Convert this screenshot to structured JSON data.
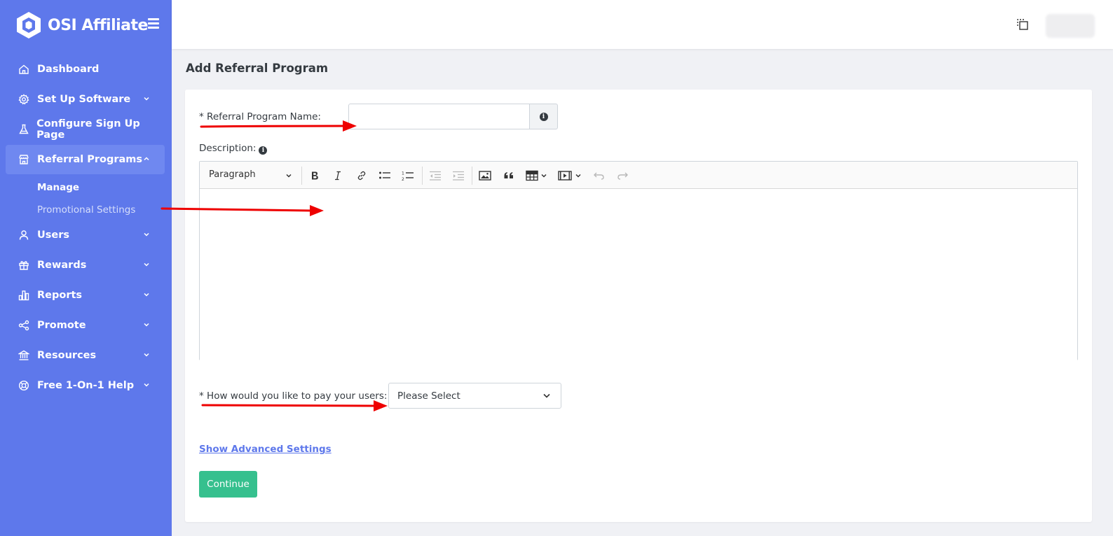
{
  "brand": {
    "name": "OSI Affiliate"
  },
  "sidebar": {
    "items": [
      {
        "label": "Dashboard",
        "icon": "home-icon"
      },
      {
        "label": "Set Up Software",
        "icon": "gear-icon"
      },
      {
        "label": "Configure Sign Up Page",
        "icon": "flask-icon"
      },
      {
        "label": "Referral Programs",
        "icon": "store-icon",
        "active": true
      },
      {
        "label": "Users",
        "icon": "user-icon"
      },
      {
        "label": "Rewards",
        "icon": "gift-icon"
      },
      {
        "label": "Reports",
        "icon": "bar-chart-icon"
      },
      {
        "label": "Promote",
        "icon": "share-icon"
      },
      {
        "label": "Resources",
        "icon": "bank-icon"
      },
      {
        "label": "Free 1-On-1 Help",
        "icon": "lifebuoy-icon"
      }
    ],
    "subitems": [
      {
        "label": "Manage"
      },
      {
        "label": "Promotional Settings"
      }
    ]
  },
  "page": {
    "title": "Add Referral Program"
  },
  "form": {
    "name_label": "* Referral Program Name:",
    "name_value": "",
    "description_label": "Description:",
    "editor": {
      "paragraph_label": "Paragraph"
    },
    "pay_label": "* How would you like to pay your users:",
    "pay_selected": "Please Select",
    "advanced_link": "Show Advanced Settings",
    "continue_label": "Continue"
  },
  "colors": {
    "sidebar_bg": "#5e78eb",
    "sidebar_active": "#6f88f0",
    "continue_button": "#36c08e",
    "link": "#5e78eb",
    "annotation_arrow": "#ee0000"
  }
}
